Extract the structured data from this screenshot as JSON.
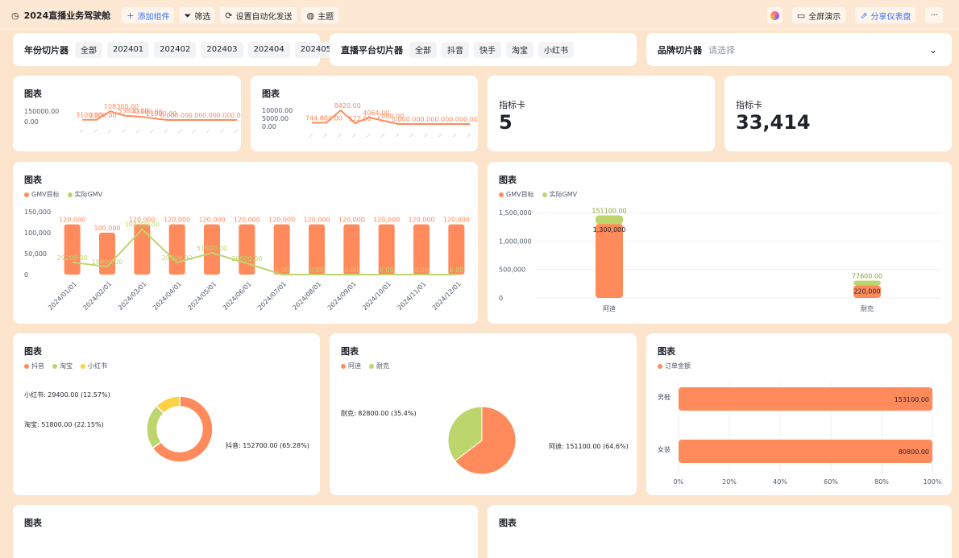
{
  "topbar": {
    "title": "2024直播业务驾驶舱",
    "add_widget": "添加组件",
    "filter": "筛选",
    "automation": "设置自动化发送",
    "theme": "主题",
    "fullscreen": "全屏演示",
    "share": "分享仪表盘",
    "more": "···"
  },
  "slicers": {
    "year": {
      "label": "年份切片器",
      "options": [
        "全部",
        "202401",
        "202402",
        "202403",
        "202404",
        "202405"
      ]
    },
    "platform": {
      "label": "直播平台切片器",
      "options": [
        "全部",
        "抖音",
        "快手",
        "淘宝",
        "小红书"
      ]
    },
    "brand": {
      "label": "品牌切片器",
      "placeholder": "请选择"
    }
  },
  "cards": {
    "chart_title": "图表",
    "metric1": {
      "label": "指标卡",
      "value": "5"
    },
    "metric2": {
      "label": "指标卡",
      "value": "33,414"
    }
  },
  "colors": {
    "orange": "#ff8a5b",
    "green": "#bcd66d",
    "yellow": "#fcd144"
  },
  "chart_data": [
    {
      "type": "line",
      "y_ticks": [
        "150000.00",
        "0.00"
      ],
      "series": [
        {
          "values": [
            3100,
            2500,
            108300,
            53800,
            43100,
            21900,
            0,
            0,
            0,
            0,
            0,
            0
          ],
          "labels": [
            "3100.00",
            "2500.00",
            "108300.00",
            "53800.00",
            "43100.00",
            "21900.00",
            "0.00",
            "0.00",
            "0.00",
            "0.00",
            "0.00",
            "0.00"
          ]
        }
      ]
    },
    {
      "type": "line",
      "y_ticks": [
        "10000.00",
        "5000.00",
        "0.00"
      ],
      "series": [
        {
          "values": [
            744,
            800,
            8420,
            522,
            4064,
            2000,
            0,
            0,
            0,
            0,
            0,
            0
          ],
          "labels": [
            "744.00",
            "800.00",
            "8420.00",
            "522.00",
            "4064.00",
            "2000.00",
            "0.00",
            "0.00",
            "0.00",
            "0.00",
            "0.00",
            "0.00"
          ]
        }
      ]
    },
    {
      "type": "bar",
      "categories": [
        "2024/01/01",
        "2024/02/01",
        "2024/03/01",
        "2024/04/01",
        "2024/05/01",
        "2024/06/01",
        "2024/07/01",
        "2024/08/01",
        "2024/09/01",
        "2024/10/01",
        "2024/11/01",
        "2024/12/01"
      ],
      "y_ticks": [
        "150,000",
        "100,000",
        "50,000",
        "0"
      ],
      "ylim": [
        0,
        150000
      ],
      "series": [
        {
          "name": "GMV目标",
          "type": "bar",
          "values": [
            120000,
            100000,
            120000,
            120000,
            120000,
            120000,
            120000,
            120000,
            120000,
            120000,
            120000,
            120000
          ],
          "labels": [
            "120,000",
            "100,000",
            "120,000",
            "120,000",
            "120,000",
            "120,000",
            "120,000",
            "120,000",
            "120,000",
            "120,000",
            "120,000",
            "120,000"
          ]
        },
        {
          "name": "实际GMV",
          "type": "line",
          "values": [
            29200,
            18900,
            108300,
            29100,
            51800,
            26900,
            0,
            0,
            0,
            0,
            0,
            0
          ],
          "labels": [
            "29200.00",
            "18900.00",
            "108300.00",
            "29100.00",
            "51800.00",
            "26900.00",
            "0.00",
            "0.00",
            "0.00",
            "0.00",
            "0.00",
            "0.00"
          ]
        }
      ]
    },
    {
      "type": "bar",
      "categories": [
        "阿迪",
        "耐克"
      ],
      "y_ticks": [
        "1,500,000",
        "1,000,000",
        "500,000",
        "0"
      ],
      "ylim": [
        0,
        1500000
      ],
      "series": [
        {
          "name": "GMV目标",
          "values": [
            1300000,
            220000
          ],
          "labels": [
            "1,300,000",
            "220,000"
          ]
        },
        {
          "name": "实际GMV",
          "values": [
            151100,
            77600
          ],
          "labels": [
            "151100.00",
            "77600.00"
          ]
        }
      ]
    },
    {
      "type": "pie",
      "donut": true,
      "slices": [
        {
          "name": "抖音",
          "value": 152700,
          "label": "抖音: 152700.00 (65.28%)"
        },
        {
          "name": "淘宝",
          "value": 51800,
          "label": "淘宝: 51800.00 (22.15%)"
        },
        {
          "name": "小红书",
          "value": 29400,
          "label": "小红书: 29400.00 (12.57%)"
        }
      ]
    },
    {
      "type": "pie",
      "slices": [
        {
          "name": "阿迪",
          "value": 151100,
          "label": "阿迪: 151100.00 (64.6%)"
        },
        {
          "name": "耐克",
          "value": 82800,
          "label": "耐克: 82800.00 (35.4%)"
        }
      ]
    },
    {
      "type": "bar",
      "orientation": "horizontal",
      "series": [
        {
          "name": "订单金额",
          "values": [
            153100,
            80800
          ],
          "labels": [
            "153100.00",
            "80800.00"
          ]
        }
      ],
      "categories": [
        "男鞋",
        "女装"
      ],
      "x_ticks": [
        "0%",
        "20%",
        "40%",
        "60%",
        "80%",
        "100%"
      ]
    }
  ]
}
